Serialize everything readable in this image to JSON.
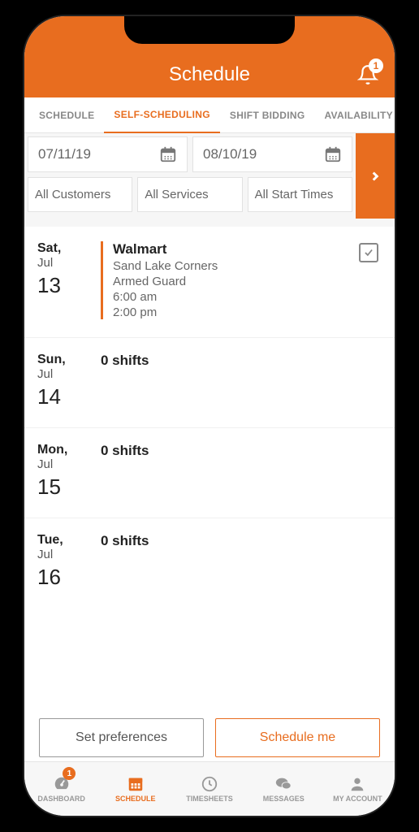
{
  "header": {
    "title": "Schedule",
    "notifications_badge": "1"
  },
  "tabs": [
    {
      "label": "SCHEDULE"
    },
    {
      "label": "SELF-SCHEDULING",
      "active": true
    },
    {
      "label": "SHIFT BIDDING"
    },
    {
      "label": "AVAILABILITY"
    }
  ],
  "filters": {
    "date_from": "07/11/19",
    "date_to": "08/10/19",
    "customers": "All Customers",
    "services": "All Services",
    "start_times": "All Start Times"
  },
  "days": [
    {
      "weekday": "Sat,",
      "month": "Jul",
      "day": "13",
      "shifts": [
        {
          "client": "Walmart",
          "location": "Sand Lake Corners",
          "role": "Armed Guard",
          "start": "6:00 am",
          "end": "2:00 pm",
          "checked": true
        }
      ]
    },
    {
      "weekday": "Sun,",
      "month": "Jul",
      "day": "14",
      "zero_label": "0 shifts"
    },
    {
      "weekday": "Mon,",
      "month": "Jul",
      "day": "15",
      "zero_label": "0 shifts"
    },
    {
      "weekday": "Tue,",
      "month": "Jul",
      "day": "16",
      "zero_label": "0 shifts"
    }
  ],
  "buttons": {
    "preferences": "Set preferences",
    "schedule_me": "Schedule me"
  },
  "bottom_nav": [
    {
      "label": "DASHBOARD",
      "badge": "1"
    },
    {
      "label": "SCHEDULE",
      "active": true
    },
    {
      "label": "TIMESHEETS"
    },
    {
      "label": "MESSAGES"
    },
    {
      "label": "MY ACCOUNT"
    }
  ]
}
